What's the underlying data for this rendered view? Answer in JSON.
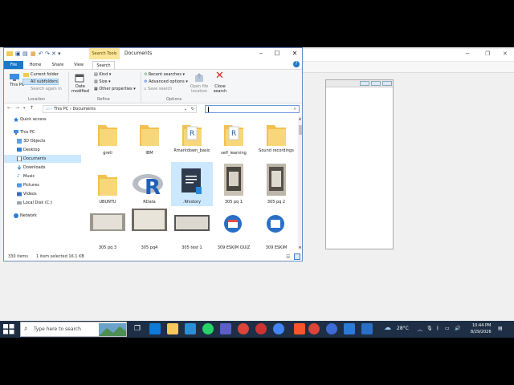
{
  "explorer": {
    "title": "Documents",
    "search_tools_label": "Search Tools",
    "tabs": {
      "file": "File",
      "home": "Home",
      "share": "Share",
      "view": "View",
      "search": "Search"
    },
    "ribbon": {
      "this_pc": "This PC",
      "current_folder": "Current folder",
      "all_subfolders": "All subfolders",
      "search_again_in": "Search again in",
      "location_group": "Location",
      "date_modified": "Date modified",
      "kind": "Kind",
      "size": "Size",
      "other_properties": "Other properties",
      "refine_group": "Refine",
      "recent_searches": "Recent searches",
      "advanced_options": "Advanced options",
      "save_search": "Save search",
      "open_file_location": "Open file location",
      "close_search": "Close search",
      "options_group": "Options"
    },
    "address": {
      "this_pc": "This PC",
      "sep": "›",
      "folder": "Documents"
    },
    "nav": [
      {
        "label": "Quick access"
      },
      {
        "label": "This PC"
      },
      {
        "label": "3D Objects"
      },
      {
        "label": "Desktop"
      },
      {
        "label": "Documents"
      },
      {
        "label": "Downloads"
      },
      {
        "label": "Music"
      },
      {
        "label": "Pictures"
      },
      {
        "label": "Videos"
      },
      {
        "label": "Local Disk (C:)"
      },
      {
        "label": "Network"
      }
    ],
    "files": [
      {
        "label": "gretl"
      },
      {
        "label": "IBM"
      },
      {
        "label": "Rmarkdown_basic"
      },
      {
        "label": "self_learning"
      },
      {
        "label": "Sound recordings"
      },
      {
        "label": "UBUNTU"
      },
      {
        "label": "RData"
      },
      {
        "label": ".Rhistory"
      },
      {
        "label": "305 pq 1"
      },
      {
        "label": "305 pq 2"
      },
      {
        "label": "305 pq 3"
      },
      {
        "label": "305 pq4"
      },
      {
        "label": "305 test 1"
      },
      {
        "label": "309 ESKIM QUIZ"
      },
      {
        "label": "309 ESKIM"
      }
    ],
    "status": {
      "count": "330 items",
      "selected": "1 item selected  16.1 KB"
    }
  },
  "taskbar": {
    "search_placeholder": "Type here to search",
    "weather": "28°C",
    "time": "10:44 PM",
    "date": "8/29/2026"
  },
  "colors": {
    "accent": "#1979ca",
    "folder": "#f4c85a",
    "taskbar": "#1e2f45",
    "selection": "#cce8ff"
  }
}
